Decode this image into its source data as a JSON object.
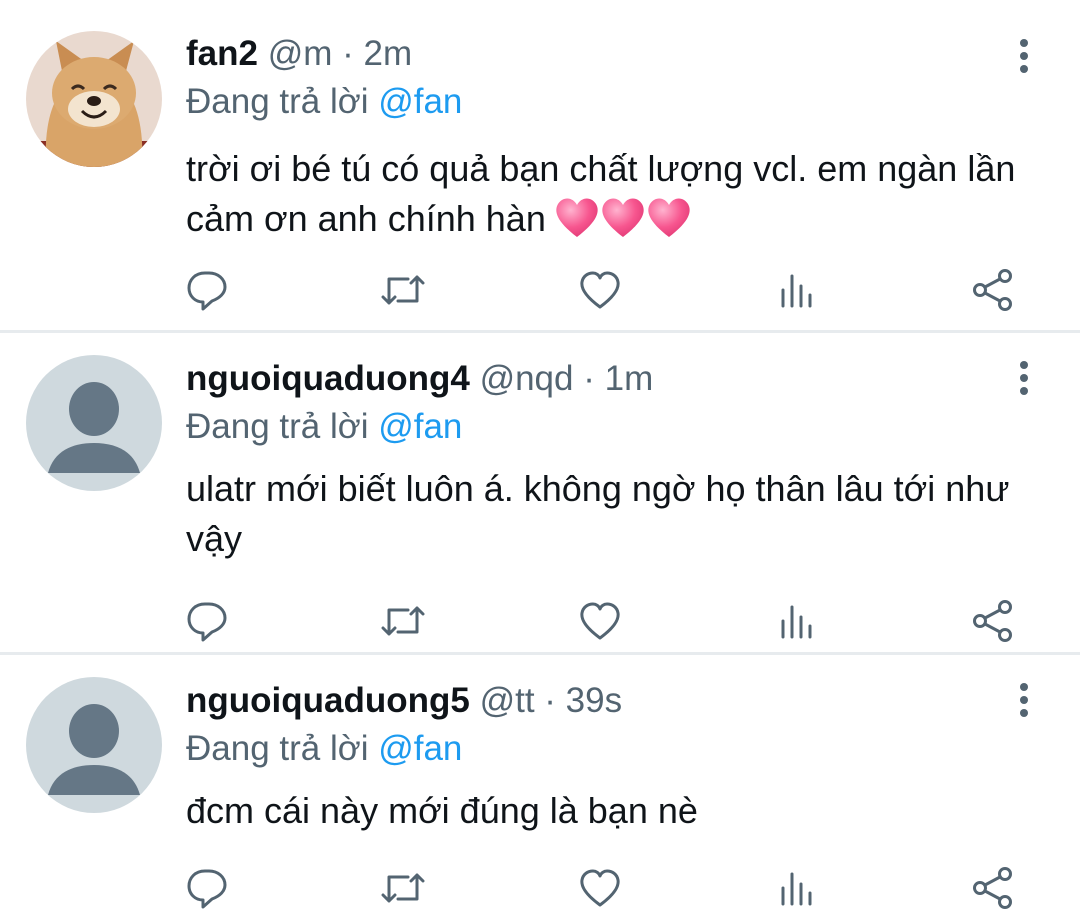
{
  "tweets": [
    {
      "name": "fan2",
      "handle": "@m",
      "separator": "·",
      "time": "2m",
      "reply_prefix": "Đang trả lời",
      "reply_to": "@fan",
      "text": "trời ơi bé tú có quả bạn chất lượng vcl. em ngàn lần cảm ơn anh chính hàn",
      "emoji": [
        "pink-heart",
        "pink-heart",
        "pink-heart"
      ],
      "avatar": "dog-photo"
    },
    {
      "name": "nguoiquaduong4",
      "handle": "@nqd",
      "separator": "·",
      "time": "1m",
      "reply_prefix": "Đang trả lời",
      "reply_to": "@fan",
      "text": "ulatr mới biết luôn á. không ngờ họ thân lâu tới như vậy",
      "avatar": "default-avatar"
    },
    {
      "name": "nguoiquaduong5",
      "handle": "@tt",
      "separator": "·",
      "time": "39s",
      "reply_prefix": "Đang trả lời",
      "reply_to": "@fan",
      "text": "đcm cái này mới đúng là bạn nè",
      "avatar": "default-avatar"
    }
  ],
  "actions": [
    "reply-icon",
    "retweet-icon",
    "like-icon",
    "analytics-icon",
    "share-icon"
  ],
  "colors": {
    "text": "#0f1419",
    "secondary": "#536471",
    "link": "#1d9bf0",
    "icon": "#536471",
    "divider": "#e7ebee",
    "default_avatar_bg": "#cfd9de",
    "default_avatar_fg": "#657786"
  }
}
